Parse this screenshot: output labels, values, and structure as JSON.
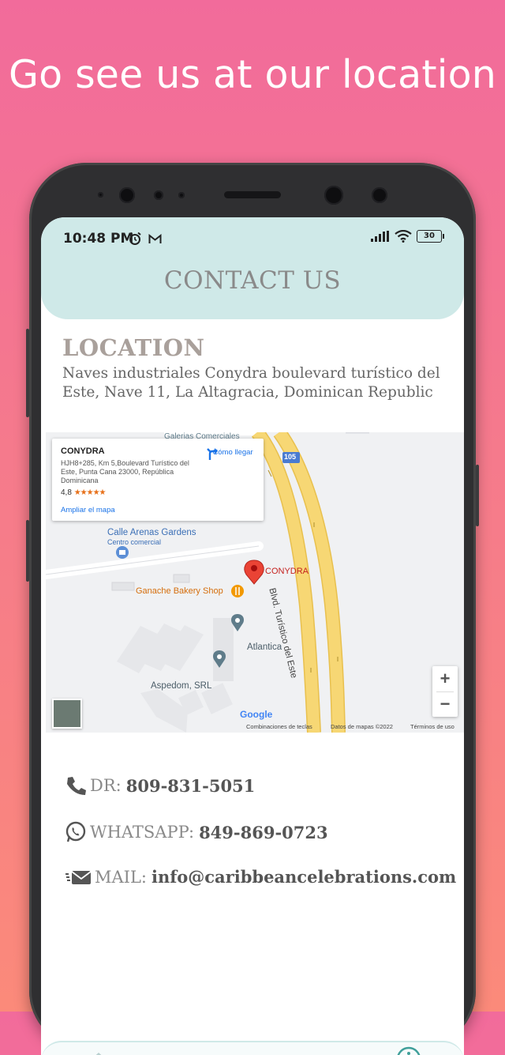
{
  "promo": {
    "headline": "Go see us at our location"
  },
  "status_bar": {
    "time": "10:48 PM",
    "battery": "30"
  },
  "header": {
    "title": "CONTACT US"
  },
  "location": {
    "title": "LOCATION",
    "address": "Naves industriales Conydra boulevard turístico del Este, Nave 11, La Altagracia, Dominican Republic"
  },
  "map": {
    "card": {
      "name": "CONYDRA",
      "address": "HJH8+285, Km 5,Boulevard Turístico del Este, Punta Cana 23000, República Dominicana",
      "rating": "4,8",
      "stars": "★★★★★",
      "directions_label": "Cómo llegar",
      "enlarge_link": "Ampliar el mapa"
    },
    "labels": {
      "galerias": "Galerias Comerciales",
      "highway_shield": "105",
      "arenas": "Calle Arenas Gardens",
      "centro": "Centro comercial",
      "conydra_pin": "CONYDRA",
      "ganache": "Ganache Bakery Shop",
      "boulevard": "Blvd. Turístico del Este",
      "atlantica": "Atlantica",
      "aspedom": "Aspedom, SRL"
    },
    "zoom_in": "+",
    "zoom_out": "−",
    "google": "Google",
    "footer": {
      "shortcuts": "Combinaciones de teclas",
      "map_data": "Datos de mapas ©2022",
      "terms": "Términos de uso"
    },
    "colors": {
      "road": "#f7d774",
      "road_edge": "#e8c04e",
      "pin": "#ea4335",
      "place_icon": "#5f7c8a",
      "food_icon": "#f29900"
    }
  },
  "contacts": [
    {
      "label": "DR:",
      "value": "809-831-5051",
      "icon": "phone-icon"
    },
    {
      "label": "WHATSAPP:",
      "value": "849-869-0723",
      "icon": "whatsapp-icon"
    },
    {
      "label": "MAIL:",
      "value": "info@caribbeancelebrations.com",
      "icon": "mail-icon"
    }
  ],
  "colors": {
    "header_bg": "#cfe9e8",
    "title_grey": "#8a8a8a",
    "location_title": "#a9a09b"
  }
}
